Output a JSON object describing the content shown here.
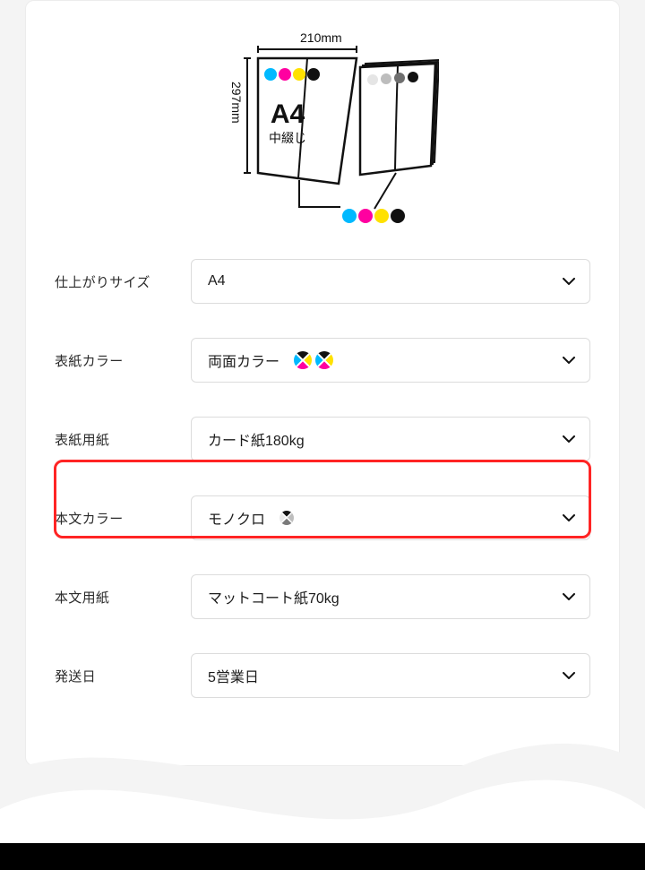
{
  "diagram": {
    "width_label": "210mm",
    "height_label": "297mm",
    "page_size": "A4",
    "binding": "中綴じ"
  },
  "rows": {
    "size": {
      "label": "仕上がりサイズ",
      "value": "A4"
    },
    "cover_color": {
      "label": "表紙カラー",
      "value": "両面カラー"
    },
    "cover_paper": {
      "label": "表紙用紙",
      "value": "カード紙180kg"
    },
    "body_color": {
      "label": "本文カラー",
      "value": "モノクロ"
    },
    "body_paper": {
      "label": "本文用紙",
      "value": "マットコート紙70kg"
    },
    "ship_date": {
      "label": "発送日",
      "value": "5営業日"
    }
  },
  "colors": {
    "cyan": "#00b9ff",
    "magenta": "#ff00a0",
    "yellow": "#ffe100",
    "black": "#111111",
    "highlight": "#ff2424"
  }
}
